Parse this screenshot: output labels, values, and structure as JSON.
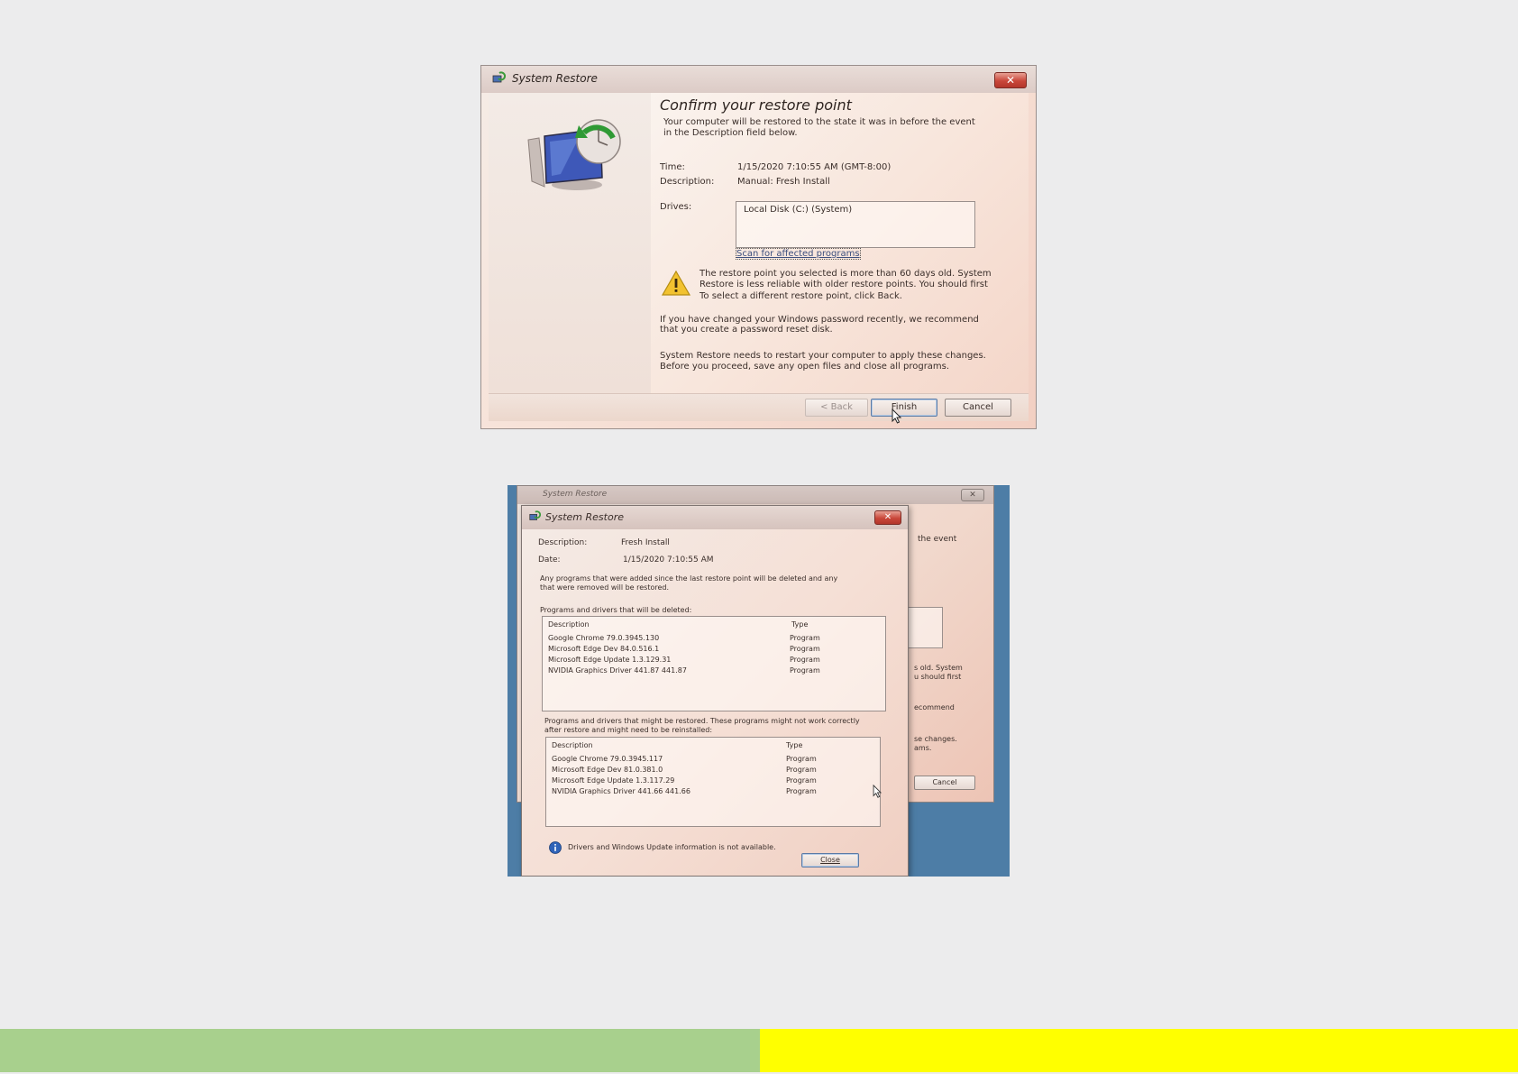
{
  "top_dialog": {
    "title": "System Restore",
    "close_glyph": "✕",
    "heading": "Confirm your restore point",
    "intro_line1": "Your computer will be restored to the state it was in before the event",
    "intro_line2": "in the Description field below.",
    "time_label": "Time:",
    "time_value": "1/15/2020 7:10:55 AM (GMT-8:00)",
    "description_label": "Description:",
    "description_value": "Manual: Fresh Install",
    "drives_label": "Drives:",
    "drives_value": "Local Disk (C:) (System)",
    "scan_link": "Scan for affected programs",
    "warning_line1": "The restore point you selected is more than 60 days old. System",
    "warning_line2": "Restore is less reliable with older restore points. You should first",
    "warning_line3": "To select a different restore point, click Back.",
    "password_line1": "If you have changed your Windows password recently, we recommend",
    "password_line2": "that you create a password reset disk.",
    "restart_line1": "System Restore needs to restart your computer to apply these changes.",
    "restart_line2": "Before you proceed, save any open files and close all programs.",
    "back_button": "< Back",
    "finish_button": "Finish",
    "cancel_button": "Cancel"
  },
  "bottom_dialog": {
    "behind_title": "System Restore",
    "behind_fragments": {
      "event": "the event",
      "old": "s old. System",
      "first": "u should first",
      "recommend": "ecommend",
      "changes": "se changes.",
      "ams": "ams.",
      "cancel": "Cancel"
    },
    "title": "System Restore",
    "close_glyph": "✕",
    "description_label": "Description:",
    "description_value": "Fresh Install",
    "date_label": "Date:",
    "date_value": "1/15/2020 7:10:55 AM",
    "note_line1": "Any programs that were added since the last restore point will be deleted and any",
    "note_line2": "that were removed will be restored.",
    "deleted_heading": "Programs and drivers that will be deleted:",
    "col_description": "Description",
    "col_type": "Type",
    "deleted_rows": [
      {
        "name": "Google Chrome 79.0.3945.130",
        "type": "Program"
      },
      {
        "name": "Microsoft Edge Dev 84.0.516.1",
        "type": "Program"
      },
      {
        "name": "Microsoft Edge Update 1.3.129.31",
        "type": "Program"
      },
      {
        "name": "NVIDIA Graphics Driver 441.87 441.87",
        "type": "Program"
      }
    ],
    "restored_heading_line1": "Programs and drivers that might be restored. These programs might not work correctly",
    "restored_heading_line2": "after restore and might need to be reinstalled:",
    "restored_rows": [
      {
        "name": "Google Chrome 79.0.3945.117",
        "type": "Program"
      },
      {
        "name": "Microsoft Edge Dev 81.0.381.0",
        "type": "Program"
      },
      {
        "name": "Microsoft Edge Update 1.3.117.29",
        "type": "Program"
      },
      {
        "name": "NVIDIA Graphics Driver 441.66 441.66",
        "type": "Program"
      }
    ],
    "info_text": "Drivers and Windows Update information is not available.",
    "close_button": "Close"
  },
  "colors": {
    "bar_left": "#a8d08d",
    "bar_right": "#ffff00",
    "close_red": "#c9473a"
  }
}
